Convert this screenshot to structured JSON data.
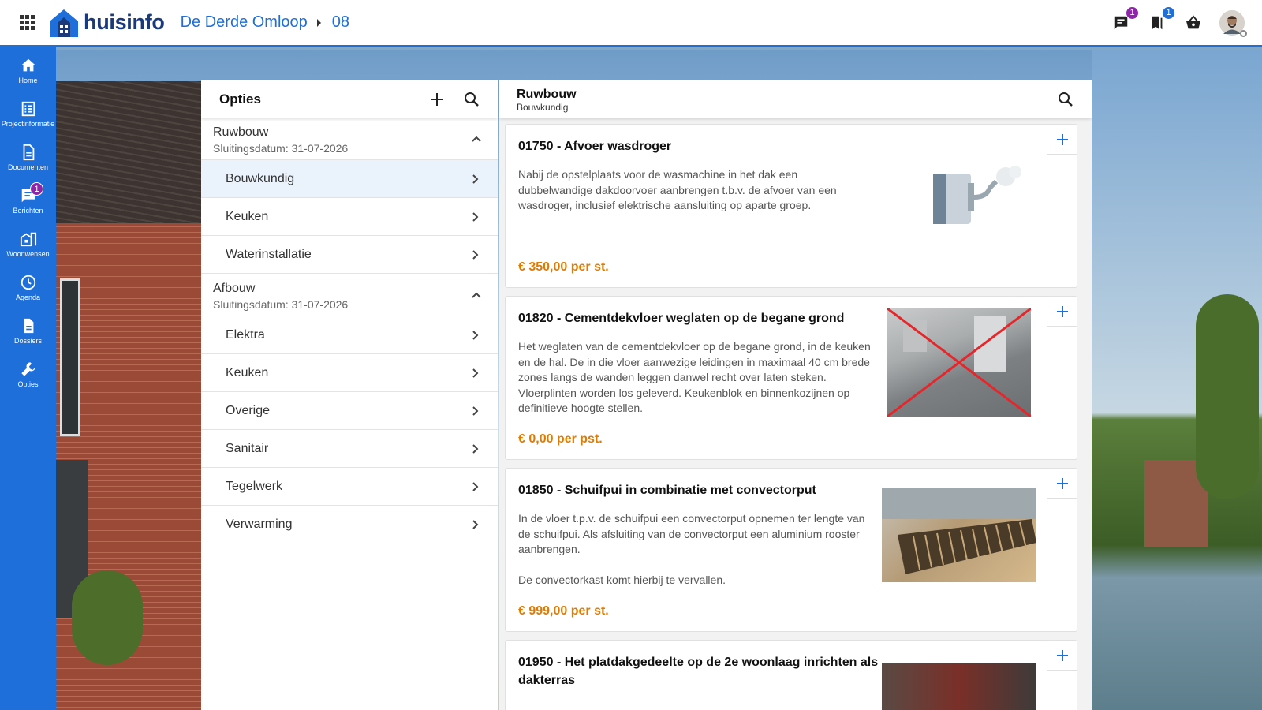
{
  "topbar": {
    "logo_text": "huisinfo",
    "breadcrumb": [
      "De Derde Omloop",
      "08"
    ],
    "messages_badge": "1",
    "bookmarks_badge": "1"
  },
  "sidenav": {
    "items": [
      {
        "label": "Home",
        "icon": "home-icon"
      },
      {
        "label": "Projectinformatie",
        "icon": "list-icon"
      },
      {
        "label": "Documenten",
        "icon": "document-icon"
      },
      {
        "label": "Berichten",
        "icon": "chat-icon",
        "badge": "1"
      },
      {
        "label": "Woonwensen",
        "icon": "building-icon"
      },
      {
        "label": "Agenda",
        "icon": "clock-icon"
      },
      {
        "label": "Dossiers",
        "icon": "file-icon"
      },
      {
        "label": "Opties",
        "icon": "wrench-icon"
      }
    ]
  },
  "left_panel": {
    "title": "Opties",
    "groups": [
      {
        "name": "Ruwbouw",
        "date": "Sluitingsdatum: 31-07-2026",
        "items": [
          "Bouwkundig",
          "Keuken",
          "Waterinstallatie"
        ]
      },
      {
        "name": "Afbouw",
        "date": "Sluitingsdatum: 31-07-2026",
        "items": [
          "Elektra",
          "Keuken",
          "Overige",
          "Sanitair",
          "Tegelwerk",
          "Verwarming"
        ]
      }
    ]
  },
  "right_panel": {
    "title": "Ruwbouw",
    "subtitle": "Bouwkundig",
    "cards": [
      {
        "title": "01750 - Afvoer wasdroger",
        "description": "Nabij de opstelplaats voor de wasmachine in het dak een\ndubbelwandige dakdoorvoer aanbrengen t.b.v. de afvoer van een\nwasdroger, inclusief elektrische aansluiting op aparte groep.",
        "price": "€ 350,00 per st."
      },
      {
        "title": "01820 - Cementdekvloer weglaten op de begane grond",
        "description": "Het weglaten van de cementdekvloer op de begane grond, in de keuken\nen de hal. De in die vloer aanwezige leidingen in maximaal 40 cm brede\nzones langs de wanden leggen danwel recht over laten steken.\nVloerplinten worden los geleverd. Keukenblok en binnenkozijnen op\ndefinitieve hoogte stellen.",
        "price": "€ 0,00 per pst."
      },
      {
        "title": "01850 - Schuifpui in combinatie met convectorput",
        "description": "In de vloer t.p.v. de schuifpui een convectorput opnemen ter lengte van\nde schuifpui. Als afsluiting van de convectorput een aluminium rooster\naanbrengen.\n\nDe convectorkast komt hierbij te vervallen.",
        "price": "€ 999,00 per st."
      },
      {
        "title": "01950 - Het platdakgedeelte op de 2e woonlaag inrichten als\ndakterras",
        "description": "",
        "price": ""
      }
    ]
  },
  "colors": {
    "primary": "#1e6fd9",
    "price": "#e07b00",
    "badge": "#8e24aa"
  }
}
